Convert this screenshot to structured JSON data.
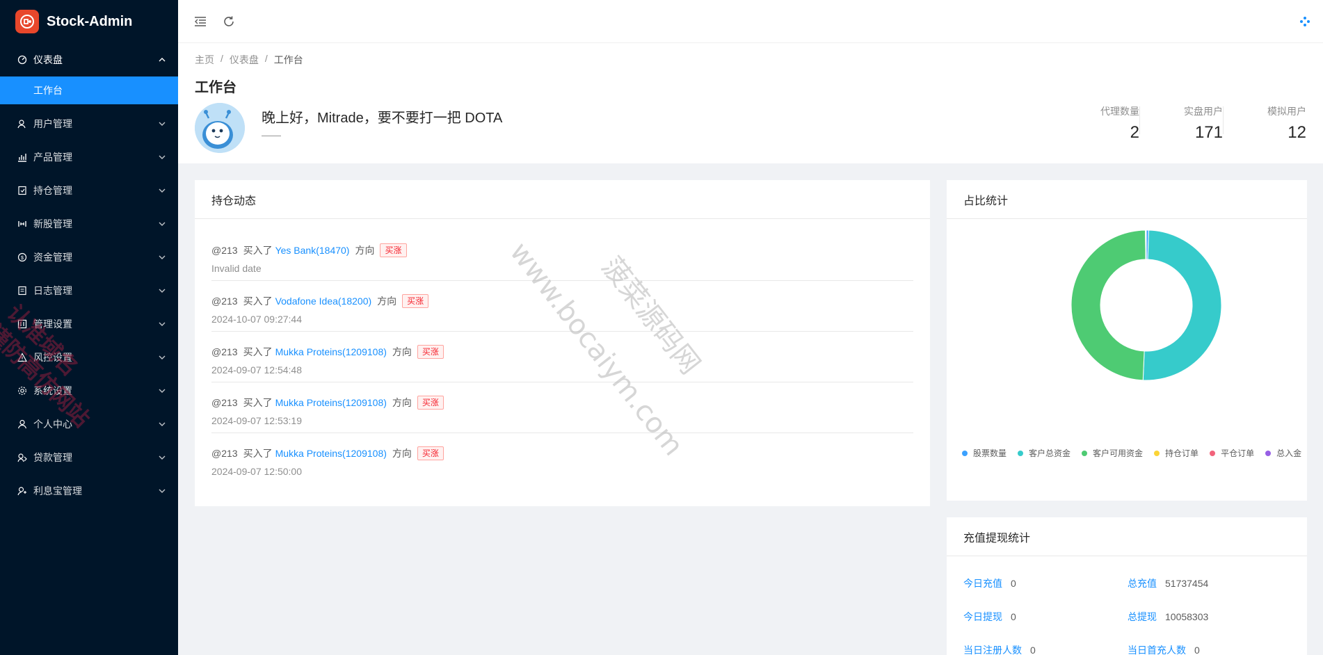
{
  "app": {
    "title": "Stock-Admin"
  },
  "sidebar": {
    "items": [
      {
        "label": "仪表盘",
        "icon": "dashboard-icon",
        "open": true
      },
      {
        "label": "用户管理",
        "icon": "user-manage-icon"
      },
      {
        "label": "产品管理",
        "icon": "bar-chart-icon"
      },
      {
        "label": "持仓管理",
        "icon": "position-icon"
      },
      {
        "label": "新股管理",
        "icon": "ipo-icon"
      },
      {
        "label": "资金管理",
        "icon": "money-icon"
      },
      {
        "label": "日志管理",
        "icon": "log-icon"
      },
      {
        "label": "管理设置",
        "icon": "manage-settings-icon"
      },
      {
        "label": "风控设置",
        "icon": "warning-icon"
      },
      {
        "label": "系统设置",
        "icon": "gear-icon"
      },
      {
        "label": "个人中心",
        "icon": "user-icon"
      },
      {
        "label": "贷款管理",
        "icon": "loan-icon"
      },
      {
        "label": "利息宝管理",
        "icon": "interest-icon"
      }
    ],
    "sub_active": "工作台"
  },
  "breadcrumb": {
    "home": "主页",
    "parent": "仪表盘",
    "current": "工作台",
    "sep": "/"
  },
  "page": {
    "title": "工作台",
    "greeting": "晚上好，Mitrade，要不要打一把 DOTA",
    "greeting_sub": "——"
  },
  "stats": [
    {
      "label": "代理数量",
      "value": "2"
    },
    {
      "label": "实盘用户",
      "value": "171"
    },
    {
      "label": "模拟用户",
      "value": "12"
    }
  ],
  "positions": {
    "title": "持仓动态",
    "items": [
      {
        "user": "@213",
        "verb": "买入了",
        "stock": "Yes Bank(18470)",
        "dir": "方向",
        "tag": "买涨",
        "date": "Invalid date"
      },
      {
        "user": "@213",
        "verb": "买入了",
        "stock": "Vodafone Idea(18200)",
        "dir": "方向",
        "tag": "买涨",
        "date": "2024-10-07 09:27:44"
      },
      {
        "user": "@213",
        "verb": "买入了",
        "stock": "Mukka Proteins(1209108)",
        "dir": "方向",
        "tag": "买涨",
        "date": "2024-09-07 12:54:48"
      },
      {
        "user": "@213",
        "verb": "买入了",
        "stock": "Mukka Proteins(1209108)",
        "dir": "方向",
        "tag": "买涨",
        "date": "2024-09-07 12:53:19"
      },
      {
        "user": "@213",
        "verb": "买入了",
        "stock": "Mukka Proteins(1209108)",
        "dir": "方向",
        "tag": "买涨",
        "date": "2024-09-07 12:50:00"
      }
    ]
  },
  "pie": {
    "title": "占比统计"
  },
  "chart_data": {
    "type": "pie",
    "donut": true,
    "categories": [
      "股票数量",
      "客户总资金",
      "客户可用资金",
      "持仓订单",
      "平仓订单",
      "总入金"
    ],
    "values": [
      0.5,
      50.2,
      49.1,
      0.05,
      0.05,
      0.1
    ],
    "colors": [
      "#3ba1ff",
      "#36cbcb",
      "#4ecb73",
      "#fbd437",
      "#f2637b",
      "#975fe5"
    ],
    "legend": "bottom"
  },
  "funds": {
    "title": "充值提现统计",
    "items": [
      {
        "label": "今日充值",
        "value": "0"
      },
      {
        "label": "总充值",
        "value": "51737454"
      },
      {
        "label": "今日提现",
        "value": "0"
      },
      {
        "label": "总提现",
        "value": "10058303"
      },
      {
        "label": "当日注册人数",
        "value": "0"
      },
      {
        "label": "当日首充人数",
        "value": "0"
      }
    ]
  },
  "watermarks": {
    "left": "认准域名\n谨防高仿网站",
    "center_url": "www.bocaiym.com",
    "center_name": "菠菜源码网"
  }
}
